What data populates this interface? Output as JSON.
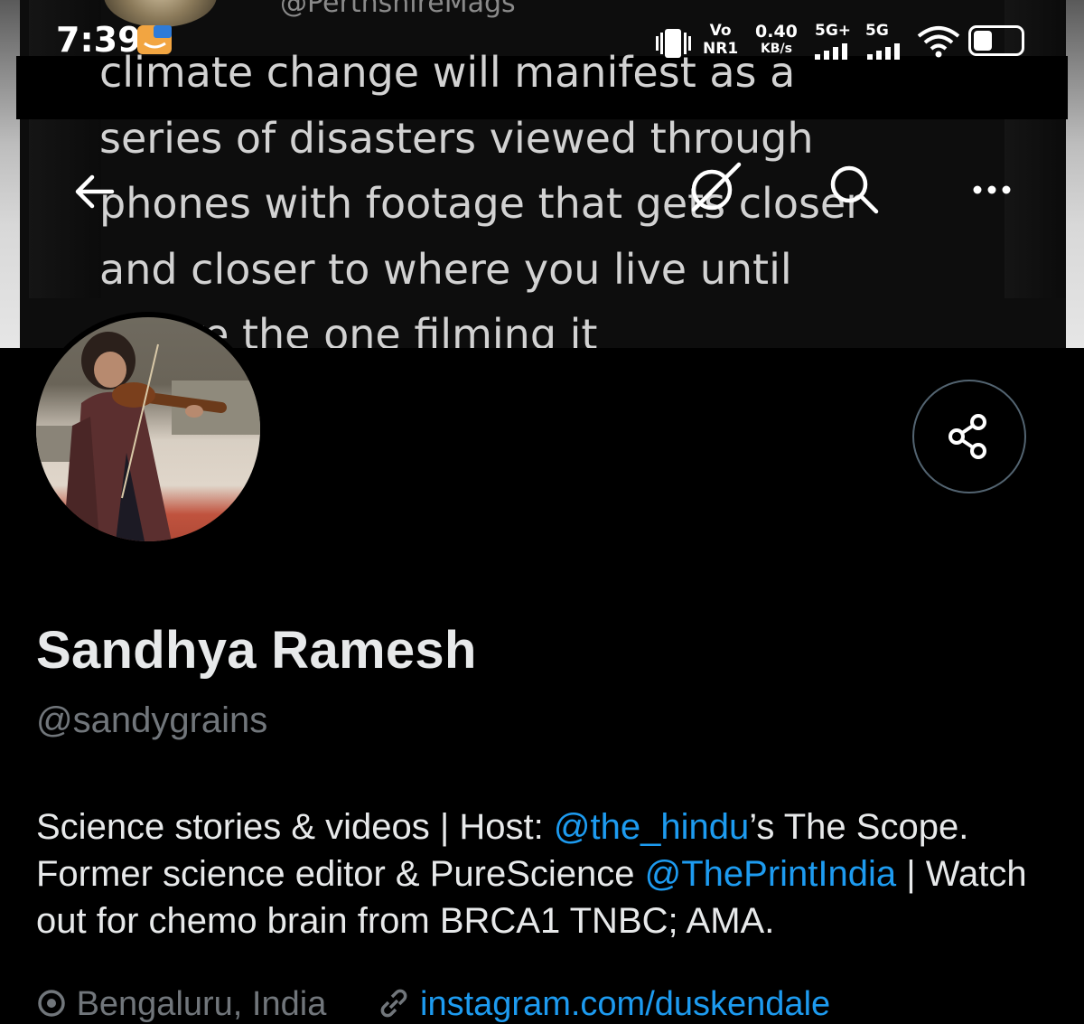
{
  "banner": {
    "quoted_handle": "@PerthshireMags",
    "quote_text": "climate change will manifest as a\nseries of disasters viewed through\nphones with footage that gets closer\nand closer to where you live until\nyou're the one filming it"
  },
  "status_bar": {
    "time": "7:39",
    "volte_top": "Vo",
    "volte_bottom": "NR1",
    "speed_value": "0.40",
    "speed_unit": "KB/s",
    "sim1_label": "5G+",
    "sim2_label": "5G",
    "battery_level": 0.4
  },
  "top_nav": {
    "icons": [
      "back-arrow-icon",
      "grok-icon",
      "search-icon",
      "more-icon"
    ]
  },
  "profile": {
    "display_name": "Sandhya Ramesh",
    "username": "@sandygrains",
    "bio": {
      "p1": "Science stories & videos | Host: ",
      "m1": "@the_hindu",
      "p2": "’s The Scope. Former science editor & PureScience ",
      "m2": "@ThePrintIndia",
      "p3": " | Watch out for chemo brain from BRCA1 TNBC; AMA."
    },
    "location": "Bengaluru, India",
    "website": "instagram.com/duskendale"
  },
  "colors": {
    "background": "#000000",
    "text": "#e7e9ea",
    "secondary_text": "#71767b",
    "accent": "#1d9bf0",
    "border": "#536471"
  }
}
